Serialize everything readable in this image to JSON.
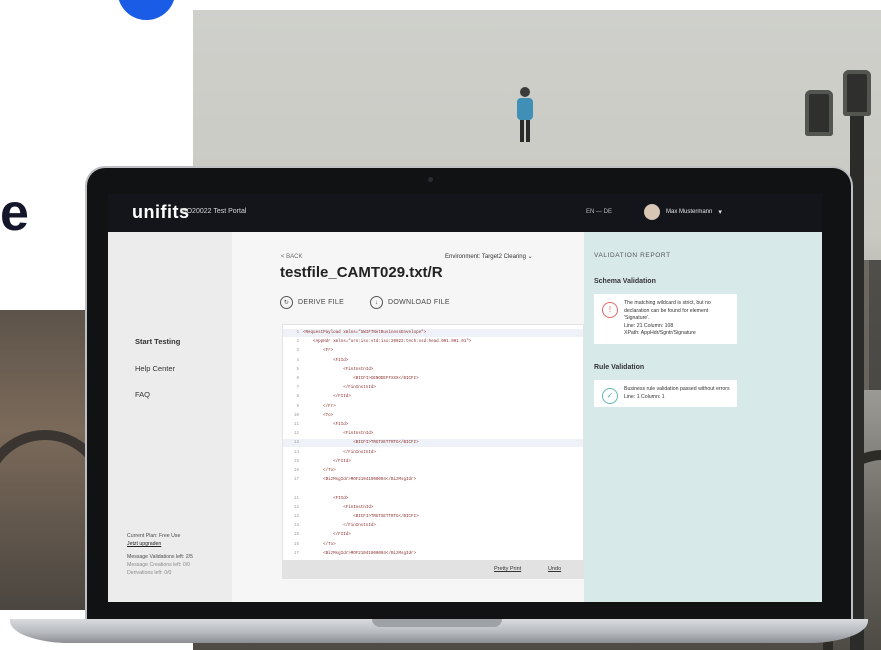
{
  "colors": {
    "accent_blue": "#1a5ce6",
    "topbar": "#13151b",
    "panel_bg": "#d8e9ea",
    "error": "#e2686a",
    "success": "#62b6b0"
  },
  "backdrop": {
    "big_letter": "e"
  },
  "app": {
    "logo": "unifits",
    "portal_name": "ISO20022 Test Portal",
    "language": "EN — DE",
    "user_name": "Max Mustermann"
  },
  "sidebar": {
    "items": [
      {
        "label": "Start Testing"
      },
      {
        "label": "Help Center"
      },
      {
        "label": "FAQ"
      }
    ],
    "plan": {
      "current_plan": "Current Plan: Free Use",
      "upgrade_link": "Jetzt upgraden",
      "validations_left": "Message Validations left: 2/5",
      "creations_left": "Message Creations left: 0/0",
      "derivations_left": "Derivations left: 0/0"
    }
  },
  "main": {
    "back_label": "< BACK",
    "environment": "Environment: Target2 Clearing",
    "file_title": "testfile_CAMT029.txt/R",
    "derive_label": "DERIVE FILE",
    "download_label": "DOWNLOAD FILE",
    "code_lines": [
      {
        "n": "1",
        "t": "<RequestPayload xmlns=\"SWIFTNetBusinessEnvelope\">"
      },
      {
        "n": "2",
        "t": "    <AppHdr xmlns=\"urn:iso:std:iso:20022:tech:xsd:head.001.001.01\">"
      },
      {
        "n": "3",
        "t": "        <Fr>"
      },
      {
        "n": "4",
        "t": "            <FIId>"
      },
      {
        "n": "5",
        "t": "                <FinInstnId>"
      },
      {
        "n": "6",
        "t": "                    <BICFI>GENODEFFXXX</BICFI>"
      },
      {
        "n": "7",
        "t": "                </FinInstnId>"
      },
      {
        "n": "8",
        "t": "            </FIId>"
      },
      {
        "n": "9",
        "t": "        </Fr>"
      },
      {
        "n": "10",
        "t": "        <To>"
      },
      {
        "n": "11",
        "t": "            <FIId>"
      },
      {
        "n": "12",
        "t": "                <FinInstnId>"
      },
      {
        "n": "13",
        "t": "                    <BICFI>TRGTXETTRTG</BICFI>"
      },
      {
        "n": "14",
        "t": "                </FinInstnId>"
      },
      {
        "n": "15",
        "t": "            </FIId>"
      },
      {
        "n": "16",
        "t": "        </To>"
      },
      {
        "n": "17",
        "t": "        <BizMsgIdr>MOF21041900004</BizMsgIdr>"
      },
      {
        "n": "",
        "t": ""
      },
      {
        "n": "11",
        "t": "            <FIId>"
      },
      {
        "n": "12",
        "t": "                <FinInstnId>"
      },
      {
        "n": "13",
        "t": "                    <BICFI>TRGTXETTRTG</BICFI>"
      },
      {
        "n": "14",
        "t": "                </FinInstnId>"
      },
      {
        "n": "15",
        "t": "            </FIId>"
      },
      {
        "n": "16",
        "t": "        </To>"
      },
      {
        "n": "17",
        "t": "        <BizMsgIdr>MOF21041900004</BizMsgIdr>"
      }
    ],
    "pretty_print": "Pretty Print",
    "undo": "Undo"
  },
  "validation": {
    "title": "VALIDATION REPORT",
    "schema_title": "Schema Validation",
    "schema_msg": "The matching wildcard is strict, but no declaration can be found for element 'Signature'.",
    "schema_line": "Line: 21 Column: 108",
    "schema_xpath": "XPath: AppHdr/Sgntr/Signature",
    "rule_title": "Rule Validation",
    "rule_msg": "Business rule validation passed without errors",
    "rule_line": "Line: 1 Column: 1"
  }
}
